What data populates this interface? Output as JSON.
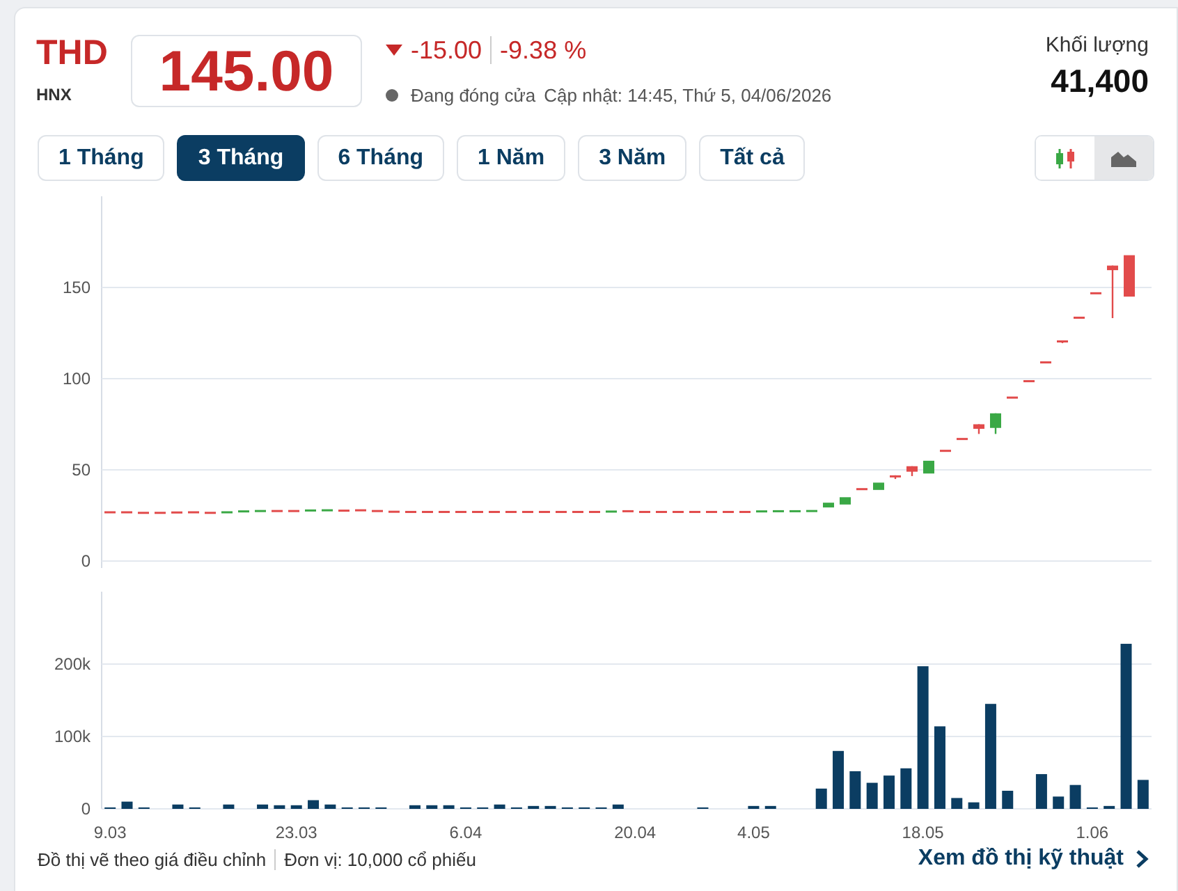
{
  "header": {
    "symbol": "THD",
    "exchange": "HNX",
    "price": "145.00",
    "is_down": true,
    "change": "-15.00",
    "change_percent": "-9.38 %",
    "market_status": "Đang đóng cửa",
    "updated": "Cập nhật: 14:45, Thứ 5, 04/06/2026",
    "volume_label": "Khối lượng",
    "volume": "41,400"
  },
  "range_tabs": [
    {
      "label": "1 Tháng",
      "selected": false
    },
    {
      "label": "3 Tháng",
      "selected": true
    },
    {
      "label": "6 Tháng",
      "selected": false
    },
    {
      "label": "1 Năm",
      "selected": false
    },
    {
      "label": "3 Năm",
      "selected": false
    },
    {
      "label": "Tất cả",
      "selected": false
    }
  ],
  "chart_types": [
    {
      "kind": "candlestick",
      "selected": false
    },
    {
      "kind": "area",
      "selected": true
    }
  ],
  "price_chart": {
    "y_axis_labels": [
      "150",
      "100",
      "50",
      "0"
    ]
  },
  "volume_chart": {
    "chart_data": {
      "type": "bar",
      "ylim": [
        0,
        300000
      ],
      "yticks": [
        {
          "value": 0,
          "label": "0"
        },
        {
          "value": 100000,
          "label": "100k"
        },
        {
          "value": 200000,
          "label": "200k"
        }
      ],
      "categories": [
        "9.03",
        null,
        null,
        null,
        null,
        null,
        null,
        null,
        null,
        null,
        null,
        "23.03",
        null,
        null,
        null,
        null,
        null,
        null,
        null,
        null,
        null,
        "6.04",
        null,
        null,
        null,
        null,
        null,
        null,
        null,
        null,
        null,
        "20.04",
        null,
        null,
        null,
        null,
        null,
        null,
        "4.05",
        null,
        null,
        null,
        null,
        null,
        null,
        null,
        null,
        null,
        "18.05",
        null,
        null,
        null,
        null,
        null,
        null,
        null,
        null,
        null,
        "1.06",
        null,
        null,
        null
      ],
      "values": [
        2000,
        10000,
        2000,
        0,
        6000,
        2000,
        0,
        6000,
        0,
        6000,
        5000,
        5000,
        12000,
        6000,
        2000,
        2000,
        2000,
        0,
        5000,
        5000,
        5000,
        2000,
        2000,
        6000,
        2000,
        4000,
        4000,
        2000,
        2000,
        2000,
        6000,
        0,
        0,
        0,
        0,
        2000,
        0,
        0,
        4000,
        4000,
        0,
        0,
        28000,
        80000,
        52000,
        36000,
        46000,
        56000,
        197000,
        114000,
        15000,
        9000,
        145000,
        25000,
        0,
        48000,
        17000,
        33000,
        2000,
        4000,
        228000,
        40000
      ]
    }
  },
  "footer": {
    "notes": [
      "Đồ thị vẽ theo giá điều chỉnh",
      "Đơn vị: 10,000 cổ phiếu"
    ],
    "link": "Xem đồ thị kỹ thuật"
  }
}
